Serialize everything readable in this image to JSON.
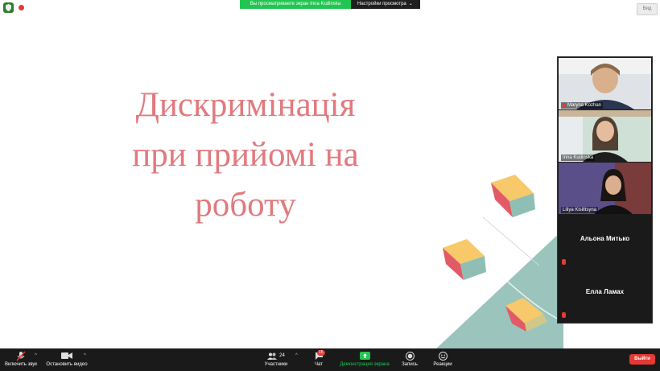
{
  "topbar": {
    "share_notice": "Вы просматриваете экран Inna Kudinska",
    "view_settings": "Настройки просмотра",
    "view_button": "Вид"
  },
  "slide": {
    "title_lines": [
      "Дискримінація",
      "при прийомі на",
      "роботу"
    ]
  },
  "participants": [
    {
      "name": "Maryna Kozhan"
    },
    {
      "name": "Inna Kudinska"
    },
    {
      "name": "Liliya Kisilitsyna"
    },
    {
      "name": "Альона Митько"
    },
    {
      "name": "Елла Ламах"
    }
  ],
  "toolbar": {
    "unmute": "Включить звук",
    "stop_video": "Остановить видео",
    "participants": "Участники",
    "participants_count": "24",
    "chat": "Чат",
    "chat_badge": "15",
    "share_screen": "Демонстрация экрана",
    "record": "Запись",
    "reactions": "Реакции",
    "leave": "Выйти"
  },
  "colors": {
    "slide_title": "#e07a7e",
    "share_green": "#23c552",
    "leave_red": "#e53935",
    "toolbar_bg": "#1a1a1a"
  }
}
